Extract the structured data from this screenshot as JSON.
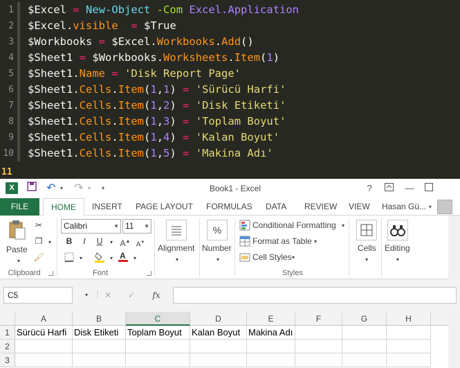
{
  "editor": {
    "lines": [
      {
        "n": "1",
        "tokens": [
          [
            "var",
            "$Excel"
          ],
          [
            "plain",
            " "
          ],
          [
            "op",
            "="
          ],
          [
            "plain",
            " "
          ],
          [
            "cmd",
            "New-Object"
          ],
          [
            "plain",
            " "
          ],
          [
            "param",
            "-Com"
          ],
          [
            "plain",
            " "
          ],
          [
            "type",
            "Excel.Application"
          ]
        ]
      },
      {
        "n": "2",
        "tokens": [
          [
            "var",
            "$Excel"
          ],
          [
            "plain",
            "."
          ],
          [
            "member",
            "visible"
          ],
          [
            "plain",
            "  "
          ],
          [
            "op",
            "="
          ],
          [
            "plain",
            " "
          ],
          [
            "var",
            "$True"
          ]
        ]
      },
      {
        "n": "3",
        "tokens": [
          [
            "var",
            "$Workbooks"
          ],
          [
            "plain",
            " "
          ],
          [
            "op",
            "="
          ],
          [
            "plain",
            " "
          ],
          [
            "var",
            "$Excel"
          ],
          [
            "plain",
            "."
          ],
          [
            "member",
            "Workbooks"
          ],
          [
            "plain",
            "."
          ],
          [
            "member",
            "Add"
          ],
          [
            "plain",
            "()"
          ]
        ]
      },
      {
        "n": "4",
        "tokens": [
          [
            "var",
            "$Sheet1"
          ],
          [
            "plain",
            " "
          ],
          [
            "op",
            "="
          ],
          [
            "plain",
            " "
          ],
          [
            "var",
            "$Workbooks"
          ],
          [
            "plain",
            "."
          ],
          [
            "member",
            "Worksheets"
          ],
          [
            "plain",
            "."
          ],
          [
            "member",
            "Item"
          ],
          [
            "plain",
            "("
          ],
          [
            "num",
            "1"
          ],
          [
            "plain",
            ")"
          ]
        ]
      },
      {
        "n": "5",
        "tokens": [
          [
            "var",
            "$Sheet1"
          ],
          [
            "plain",
            "."
          ],
          [
            "member",
            "Name"
          ],
          [
            "plain",
            " "
          ],
          [
            "op",
            "="
          ],
          [
            "plain",
            " "
          ],
          [
            "str",
            "'Disk Report Page'"
          ]
        ]
      },
      {
        "n": "6",
        "tokens": [
          [
            "var",
            "$Sheet1"
          ],
          [
            "plain",
            "."
          ],
          [
            "member",
            "Cells"
          ],
          [
            "plain",
            "."
          ],
          [
            "member",
            "Item"
          ],
          [
            "plain",
            "("
          ],
          [
            "num",
            "1"
          ],
          [
            "plain",
            ","
          ],
          [
            "num",
            "1"
          ],
          [
            "plain",
            ")"
          ],
          [
            "plain",
            " "
          ],
          [
            "op",
            "="
          ],
          [
            "plain",
            " "
          ],
          [
            "str",
            "'Sürücü Harfi'"
          ]
        ]
      },
      {
        "n": "7",
        "tokens": [
          [
            "var",
            "$Sheet1"
          ],
          [
            "plain",
            "."
          ],
          [
            "member",
            "Cells"
          ],
          [
            "plain",
            "."
          ],
          [
            "member",
            "Item"
          ],
          [
            "plain",
            "("
          ],
          [
            "num",
            "1"
          ],
          [
            "plain",
            ","
          ],
          [
            "num",
            "2"
          ],
          [
            "plain",
            ")"
          ],
          [
            "plain",
            " "
          ],
          [
            "op",
            "="
          ],
          [
            "plain",
            " "
          ],
          [
            "str",
            "'Disk Etiketi'"
          ]
        ]
      },
      {
        "n": "8",
        "tokens": [
          [
            "var",
            "$Sheet1"
          ],
          [
            "plain",
            "."
          ],
          [
            "member",
            "Cells"
          ],
          [
            "plain",
            "."
          ],
          [
            "member",
            "Item"
          ],
          [
            "plain",
            "("
          ],
          [
            "num",
            "1"
          ],
          [
            "plain",
            ","
          ],
          [
            "num",
            "3"
          ],
          [
            "plain",
            ")"
          ],
          [
            "plain",
            " "
          ],
          [
            "op",
            "="
          ],
          [
            "plain",
            " "
          ],
          [
            "str",
            "'Toplam Boyut'"
          ]
        ]
      },
      {
        "n": "9",
        "tokens": [
          [
            "var",
            "$Sheet1"
          ],
          [
            "plain",
            "."
          ],
          [
            "member",
            "Cells"
          ],
          [
            "plain",
            "."
          ],
          [
            "member",
            "Item"
          ],
          [
            "plain",
            "("
          ],
          [
            "num",
            "1"
          ],
          [
            "plain",
            ","
          ],
          [
            "num",
            "4"
          ],
          [
            "plain",
            ")"
          ],
          [
            "plain",
            " "
          ],
          [
            "op",
            "="
          ],
          [
            "plain",
            " "
          ],
          [
            "str",
            "'Kalan Boyut'"
          ]
        ]
      },
      {
        "n": "10",
        "tokens": [
          [
            "var",
            "$Sheet1"
          ],
          [
            "plain",
            "."
          ],
          [
            "member",
            "Cells"
          ],
          [
            "plain",
            "."
          ],
          [
            "member",
            "Item"
          ],
          [
            "plain",
            "("
          ],
          [
            "num",
            "1"
          ],
          [
            "plain",
            ","
          ],
          [
            "num",
            "5"
          ],
          [
            "plain",
            ")"
          ],
          [
            "plain",
            " "
          ],
          [
            "op",
            "="
          ],
          [
            "plain",
            " "
          ],
          [
            "str",
            "'Makina Adı'"
          ]
        ]
      }
    ],
    "last_line_number": "11"
  },
  "excel": {
    "window_title": "Book1 - Excel",
    "title_icons": [
      "save-icon",
      "undo-icon",
      "redo-icon",
      "customize-icon",
      "help-icon",
      "ribbon-display-icon",
      "minimize-icon",
      "maximize-icon"
    ],
    "help_glyph": "?",
    "tabs": {
      "file": "FILE",
      "home": "HOME",
      "insert": "INSERT",
      "page_layout": "PAGE LAYOUT",
      "formulas": "FORMULAS",
      "data": "DATA",
      "review": "REVIEW",
      "view": "VIEW"
    },
    "user": "Hasan Gü...",
    "ribbon": {
      "clipboard": {
        "paste": "Paste",
        "label": "Clipboard"
      },
      "font": {
        "name": "Calibri",
        "size": "11",
        "bold": "B",
        "italic": "I",
        "underline": "U",
        "label": "Font"
      },
      "alignment": {
        "label": "Alignment"
      },
      "number": {
        "label": "Number",
        "icon_text": "%"
      },
      "styles": {
        "conditional": "Conditional Formatting",
        "format_table": "Format as Table",
        "cell_styles": "Cell Styles",
        "label": "Styles"
      },
      "cells": {
        "label": "Cells"
      },
      "editing": {
        "label": "Editing"
      }
    },
    "formula_bar": {
      "name_box": "C5",
      "fx": "fx",
      "value": ""
    },
    "columns": [
      "A",
      "B",
      "C",
      "D",
      "E",
      "F",
      "G",
      "H"
    ],
    "selected_column": "C",
    "rows": [
      {
        "n": "1",
        "cells": [
          "Sürücü Harfi",
          "Disk Etiketi",
          "Toplam Boyut",
          "Kalan Boyut",
          "Makina Adı",
          "",
          "",
          ""
        ]
      },
      {
        "n": "2",
        "cells": [
          "",
          "",
          "",
          "",
          "",
          "",
          "",
          ""
        ]
      },
      {
        "n": "3",
        "cells": [
          "",
          "",
          "",
          "",
          "",
          "",
          "",
          ""
        ]
      }
    ],
    "colors": {
      "brand": "#217346",
      "editor_bg": "#272822"
    }
  }
}
